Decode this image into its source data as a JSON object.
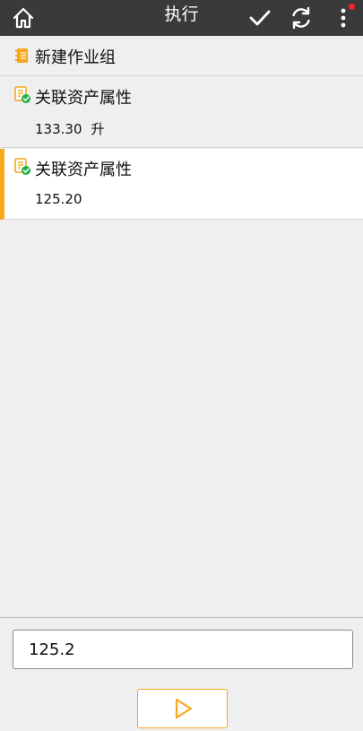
{
  "header": {
    "title": "执行",
    "icons": [
      "home-icon",
      "check-icon",
      "refresh-icon",
      "more-icon"
    ],
    "background": "#3a3a3a"
  },
  "list": {
    "group": {
      "label": "新建作业组",
      "icon": "notebook-icon"
    },
    "items": [
      {
        "title": "关联资产属性",
        "value": "133.30",
        "unit": "升",
        "icon": "task-done-icon"
      },
      {
        "title": "关联资产属性",
        "value": "125.20",
        "icon": "task-done-icon",
        "selected": true
      }
    ]
  },
  "input": {
    "value": "125.2"
  },
  "run_button": {
    "icon": "play-icon"
  },
  "colors": {
    "accent": "#f5a81c",
    "check_green": "#1fb34a",
    "notification_dot": "#ff2222"
  }
}
